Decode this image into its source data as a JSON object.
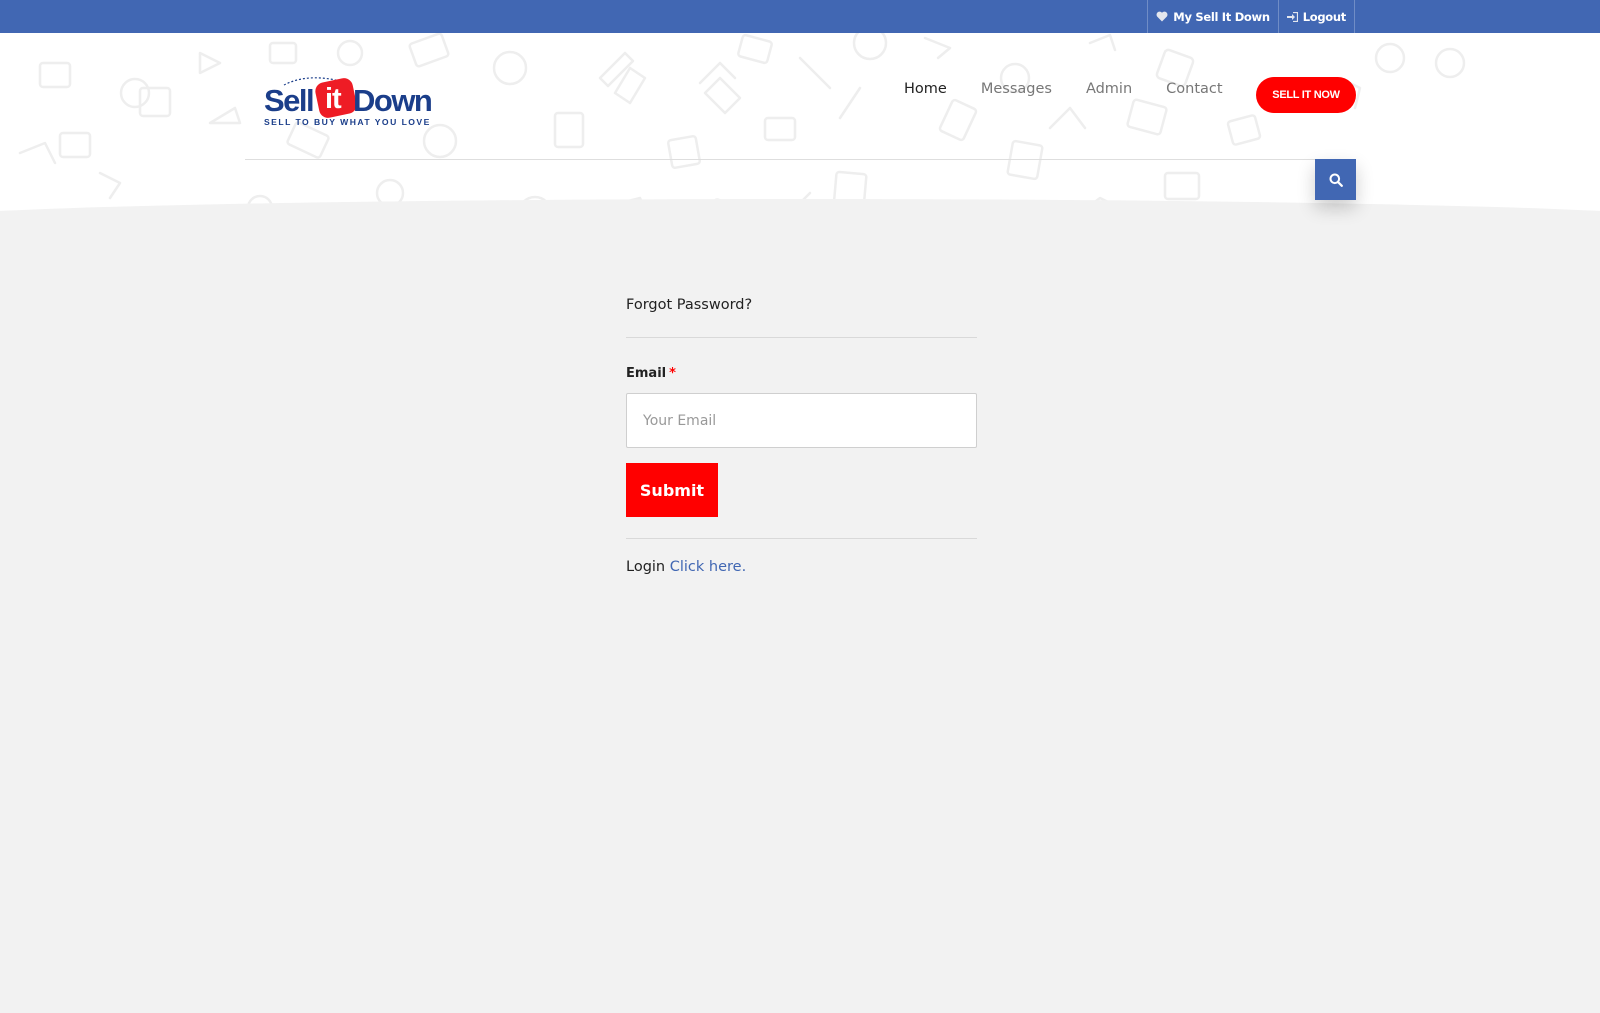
{
  "topbar": {
    "links": [
      {
        "label": "My Sell It Down",
        "icon": "heart-icon"
      },
      {
        "label": "Logout",
        "icon": "sign-in-icon"
      }
    ]
  },
  "logo": {
    "sell": "Sell",
    "it": "it",
    "down": "Down",
    "tagline": "SELL TO BUY WHAT YOU LOVE"
  },
  "nav": {
    "items": [
      "Home",
      "Messages",
      "Admin",
      "Contact"
    ],
    "active": "Home",
    "cta_label": "SELL IT NOW",
    "search_icon": "search-icon"
  },
  "form": {
    "title": "Forgot Password?",
    "email_label": "Email",
    "required_mark": "*",
    "email_placeholder": "Your Email",
    "email_value": "",
    "submit_label": "Submit",
    "login_prefix": "Login",
    "login_link": "Click here."
  },
  "colors": {
    "brand_blue": "#4167b3",
    "brand_red": "#ff0000",
    "background": "#f2f2f2"
  }
}
